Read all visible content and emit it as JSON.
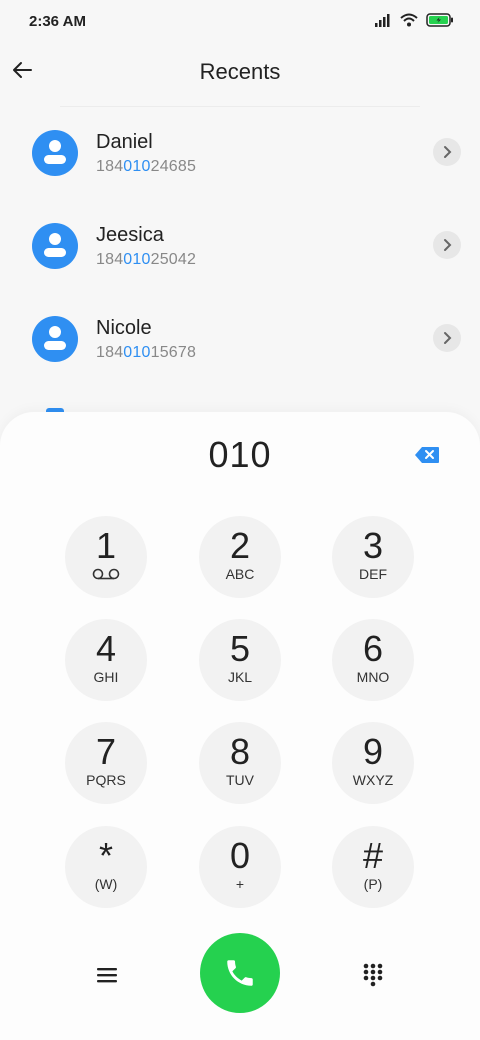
{
  "status_bar": {
    "time": "2:36 AM"
  },
  "header": {
    "title": "Recents"
  },
  "recents": [
    {
      "name": "Daniel",
      "number_prefix": "184",
      "number_match": "010",
      "number_suffix": "24685"
    },
    {
      "name": "Jeesica",
      "number_prefix": "184",
      "number_match": "010",
      "number_suffix": "25042"
    },
    {
      "name": "Nicole",
      "number_prefix": "184",
      "number_match": "010",
      "number_suffix": "15678"
    }
  ],
  "dialer": {
    "entered_number": "010",
    "keys": [
      {
        "digit": "1",
        "letters": ""
      },
      {
        "digit": "2",
        "letters": "ABC"
      },
      {
        "digit": "3",
        "letters": "DEF"
      },
      {
        "digit": "4",
        "letters": "GHI"
      },
      {
        "digit": "5",
        "letters": "JKL"
      },
      {
        "digit": "6",
        "letters": "MNO"
      },
      {
        "digit": "7",
        "letters": "PQRS"
      },
      {
        "digit": "8",
        "letters": "TUV"
      },
      {
        "digit": "9",
        "letters": "WXYZ"
      },
      {
        "digit": "*",
        "letters": "(W)"
      },
      {
        "digit": "0",
        "letters": "+"
      },
      {
        "digit": "#",
        "letters": "(P)"
      }
    ]
  },
  "colors": {
    "accent": "#2f8ff2",
    "call": "#25d14f",
    "battery": "#25d14f"
  }
}
